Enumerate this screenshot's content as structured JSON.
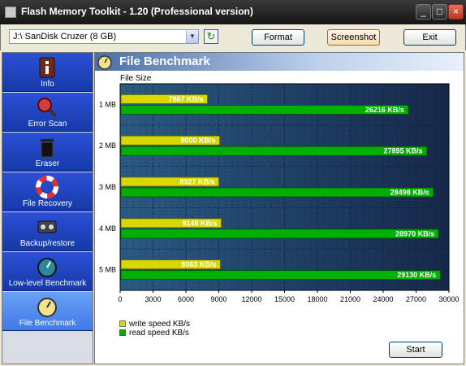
{
  "window": {
    "title": "Flash Memory Toolkit - 1.20 (Professional version)"
  },
  "toolbar": {
    "device": "J:\\ SanDisk Cruzer (8 GB)",
    "format_label": "Format",
    "screenshot_label": "Screenshot",
    "exit_label": "Exit"
  },
  "sidebar": {
    "items": [
      {
        "label": "Info",
        "icon": "info-icon"
      },
      {
        "label": "Error Scan",
        "icon": "magnifier-icon"
      },
      {
        "label": "Eraser",
        "icon": "trash-icon"
      },
      {
        "label": "File Recovery",
        "icon": "lifebuoy-icon"
      },
      {
        "label": "Backup/restore",
        "icon": "tape-icon"
      },
      {
        "label": "Low-level Benchmark",
        "icon": "stopwatch-icon"
      },
      {
        "label": "File Benchmark",
        "icon": "stopwatch-icon",
        "active": true
      }
    ]
  },
  "content": {
    "title": "File Benchmark",
    "start_label": "Start"
  },
  "chart_data": {
    "type": "bar",
    "orientation": "horizontal",
    "ylabel": "File Size",
    "categories": [
      "1 MB",
      "2 MB",
      "3 MB",
      "4 MB",
      "5 MB"
    ],
    "series": [
      {
        "name": "write speed KB/s",
        "values": [
          7887,
          9000,
          8927,
          9148,
          9063
        ],
        "labels": [
          "7887 KB/s",
          "9000 KB/s",
          "8927 KB/s",
          "9148 KB/s",
          "9063 KB/s"
        ]
      },
      {
        "name": "read speed KB/s",
        "values": [
          26216,
          27895,
          28498,
          28970,
          29130
        ],
        "labels": [
          "26216 KB/s",
          "27895 KB/s",
          "28498 KB/s",
          "28970 KB/s",
          "29130 KB/s"
        ]
      }
    ],
    "xlim": [
      0,
      30000
    ],
    "xticks": [
      "0",
      "3000",
      "6000",
      "9000",
      "12000",
      "15000",
      "18000",
      "21000",
      "24000",
      "27000",
      "30000"
    ],
    "grid": true,
    "legend_position": "bottom-left",
    "colors": {
      "write": "#d8d800",
      "read": "#00b000",
      "background": "#1f3a5e"
    }
  }
}
